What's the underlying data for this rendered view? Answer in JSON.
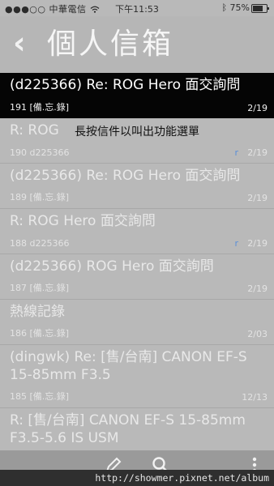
{
  "status_bar": {
    "carrier": "中華電信",
    "time": "下午11:53",
    "battery": "75%",
    "battery_level": 0.75
  },
  "header": {
    "title": "個人信箱"
  },
  "tooltip": "長按信件以叫出功能選單",
  "messages": [
    {
      "subject": "(d225366) Re: ROG Hero 面交詢問",
      "meta": "191 [備.忘.錄]",
      "date": "2/19"
    },
    {
      "subject": "R: ROG",
      "meta": "190 d225366",
      "date": "2/19",
      "badge": "r"
    },
    {
      "subject": "(d225366) Re: ROG Hero 面交詢問",
      "meta": "189 [備.忘.錄]",
      "date": "2/19"
    },
    {
      "subject": "R: ROG Hero 面交詢問",
      "meta": "188 d225366",
      "date": "2/19",
      "badge": "r"
    },
    {
      "subject": "(d225366) ROG Hero 面交詢問",
      "meta": "187 [備.忘.錄]",
      "date": "2/19"
    },
    {
      "subject": "熱線記錄",
      "meta": "186 [備.忘.錄]",
      "date": "2/03"
    },
    {
      "subject": "(dingwk) Re: [售/台南] CANON EF-S 15-85mm F3.5",
      "meta": "185 [備.忘.錄]",
      "date": "12/13"
    },
    {
      "subject": "R: [售/台南] CANON EF-S 15-85mm F3.5-5.6 IS USM",
      "meta": "",
      "date": ""
    }
  ],
  "watermark_url": "http://showmer.pixnet.net/album",
  "icons": [
    "back-chevron-icon",
    "wifi-icon",
    "bluetooth-icon",
    "compose-icon",
    "search-icon",
    "more-icon"
  ]
}
